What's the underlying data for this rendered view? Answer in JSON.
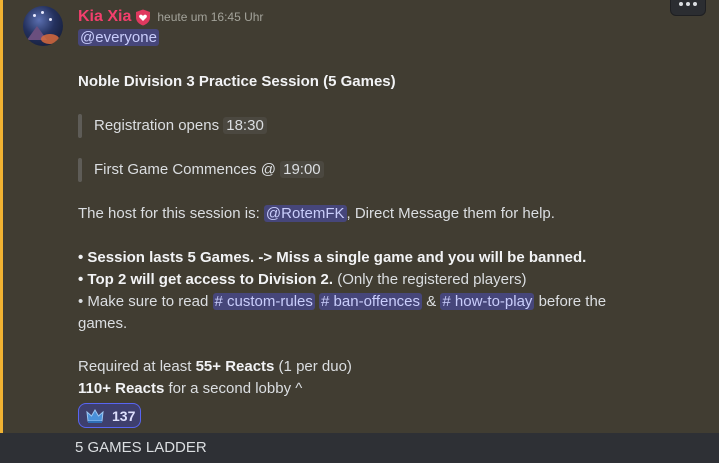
{
  "message": {
    "author": "Kia Xia",
    "timestamp": "heute um 16:45 Uhr",
    "mention_everyone": "@everyone",
    "title": "Noble Division 3 Practice Session (5 Games)",
    "quote1": {
      "text": "Registration opens",
      "time": "18:30"
    },
    "quote2": {
      "text": "First Game Commences @",
      "time": "19:00"
    },
    "host": {
      "prefix": "The host for this session is:",
      "mention": "@RotemFK",
      "suffix": ", Direct Message them for help."
    },
    "bullet1": {
      "bullet": "• ",
      "bold": "Session lasts 5 Games. -> Miss a single game and you will be banned."
    },
    "bullet2": {
      "bullet": "• ",
      "bold": "Top 2 will get access to Division 2.",
      "rest": " (Only the registered players)"
    },
    "bullet3": {
      "bullet": "• ",
      "prefix": "Make sure to read",
      "channels": [
        "# custom-rules",
        "# ban-offences",
        "# how-to-play"
      ],
      "amp": "&",
      "suffix": "before the",
      "wrap": "games."
    },
    "required": {
      "prefix": "Required at least ",
      "bold": "55+ Reacts",
      "suffix": " (1 per duo)"
    },
    "lobby": {
      "bold": "110+ Reacts",
      "suffix": " for a second lobby ^"
    }
  },
  "reaction": {
    "emoji": "crown-emoji",
    "count": "137"
  },
  "next_message": {
    "text": "5 GAMES LADDER"
  },
  "colors": {
    "highlight_bg": "#413d32",
    "highlight_border": "#f0b232",
    "username": "#f23f6d",
    "mention_bg": "#46467a"
  }
}
